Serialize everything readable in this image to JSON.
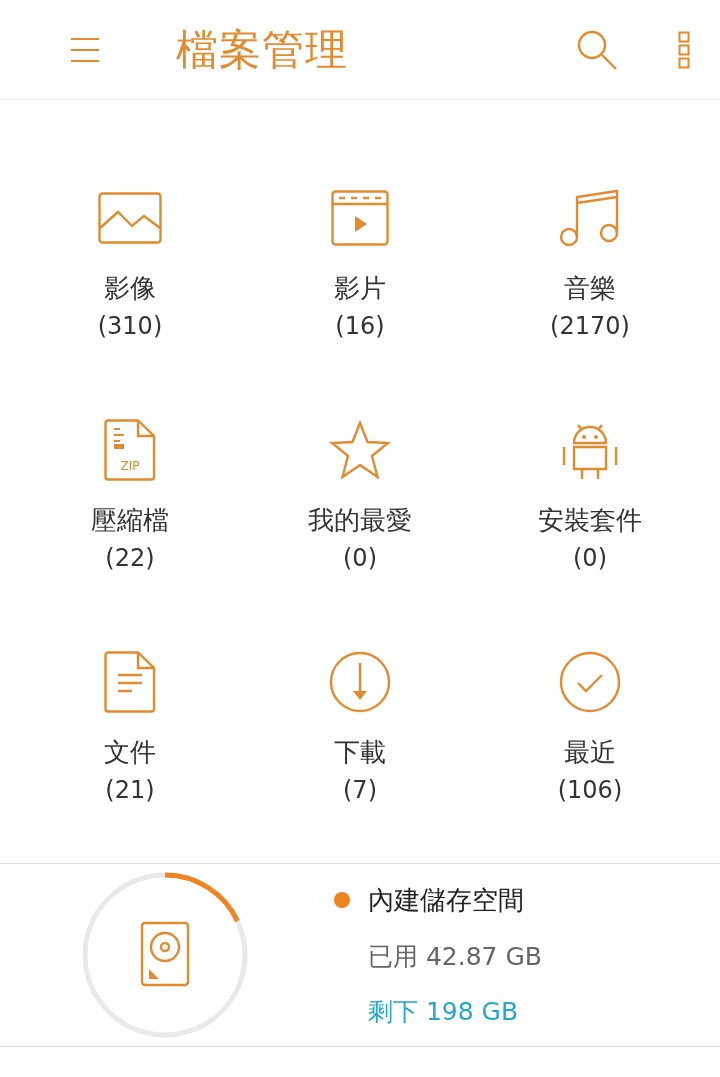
{
  "app_bar": {
    "title": "檔案管理"
  },
  "categories": [
    {
      "kind": "image",
      "label": "影像",
      "count": "(310)"
    },
    {
      "kind": "video",
      "label": "影片",
      "count": "(16)"
    },
    {
      "kind": "music",
      "label": "音樂",
      "count": "(2170)"
    },
    {
      "kind": "archive",
      "label": "壓縮檔",
      "count": "(22)",
      "icon_text": "ZIP"
    },
    {
      "kind": "favorite",
      "label": "我的最愛",
      "count": "(0)"
    },
    {
      "kind": "app",
      "label": "安裝套件",
      "count": "(0)"
    },
    {
      "kind": "document",
      "label": "文件",
      "count": "(21)"
    },
    {
      "kind": "download",
      "label": "下載",
      "count": "(7)"
    },
    {
      "kind": "recent",
      "label": "最近",
      "count": "(106)"
    }
  ],
  "storage": {
    "name": "內建儲存空間",
    "color": "#f0831e",
    "used": "已用 42.87 GB",
    "free": "剩下 198 GB",
    "level": 0.18
  }
}
